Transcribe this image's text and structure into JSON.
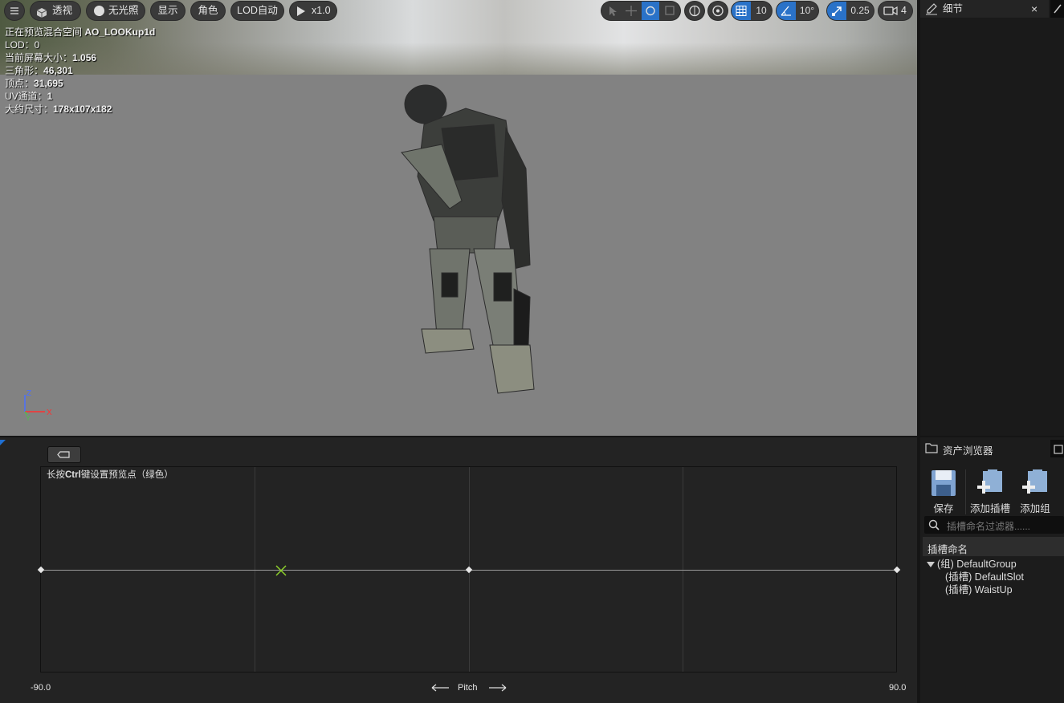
{
  "toolbar": {
    "menu_icon": "menu-icon",
    "perspective_label": "透视",
    "unlit_label": "无光照",
    "show_label": "显示",
    "character_label": "角色",
    "lod_label": "LOD自动",
    "play_speed_label": "x1.0",
    "grid_snap_value": "10",
    "rotation_snap_value": "10°",
    "scale_snap_value": "0.25",
    "camera_speed_value": "4",
    "accent_color": "#1f6fd1"
  },
  "stats": {
    "line1_prefix": "正在预览混合空间 ",
    "line1_name": "AO_LOOKup1d",
    "line2": "LOD：0",
    "line3_prefix": "当前屏幕大小：",
    "line3_value": "1.056",
    "line4_prefix": "三角形：",
    "line4_value": "46,301",
    "line5_prefix": "顶点：",
    "line5_value": "31,695",
    "line6_prefix": "UV通道：",
    "line6_value": "1",
    "line7_prefix": "大约尺寸：",
    "line7_value": "178x107x182"
  },
  "gizmo": {
    "z": "Z",
    "x": "X",
    "y": "Y"
  },
  "details": {
    "tab_label": "细节",
    "close_label": "×"
  },
  "asset_browser": {
    "tab_label": "资产浏览器",
    "save_label": "保存",
    "add_slot_label": "添加插槽",
    "add_group_label": "添加组",
    "filter_placeholder": "插槽命名过滤器......",
    "column_header": "插槽命名",
    "tree": [
      {
        "label": "(组) DefaultGroup"
      },
      {
        "label": "(插槽) DefaultSlot"
      },
      {
        "label": "(插槽) WaistUp"
      }
    ]
  },
  "blendspace": {
    "hint_prefix": "长按",
    "hint_key": "Ctrl",
    "hint_suffix": "键设置预览点（绿色）",
    "min_label": "-90.0",
    "max_label": "90.0",
    "axis_name": "Pitch",
    "preview_pitch": -39.5,
    "sample_pitches": [
      -90,
      0,
      90
    ]
  }
}
